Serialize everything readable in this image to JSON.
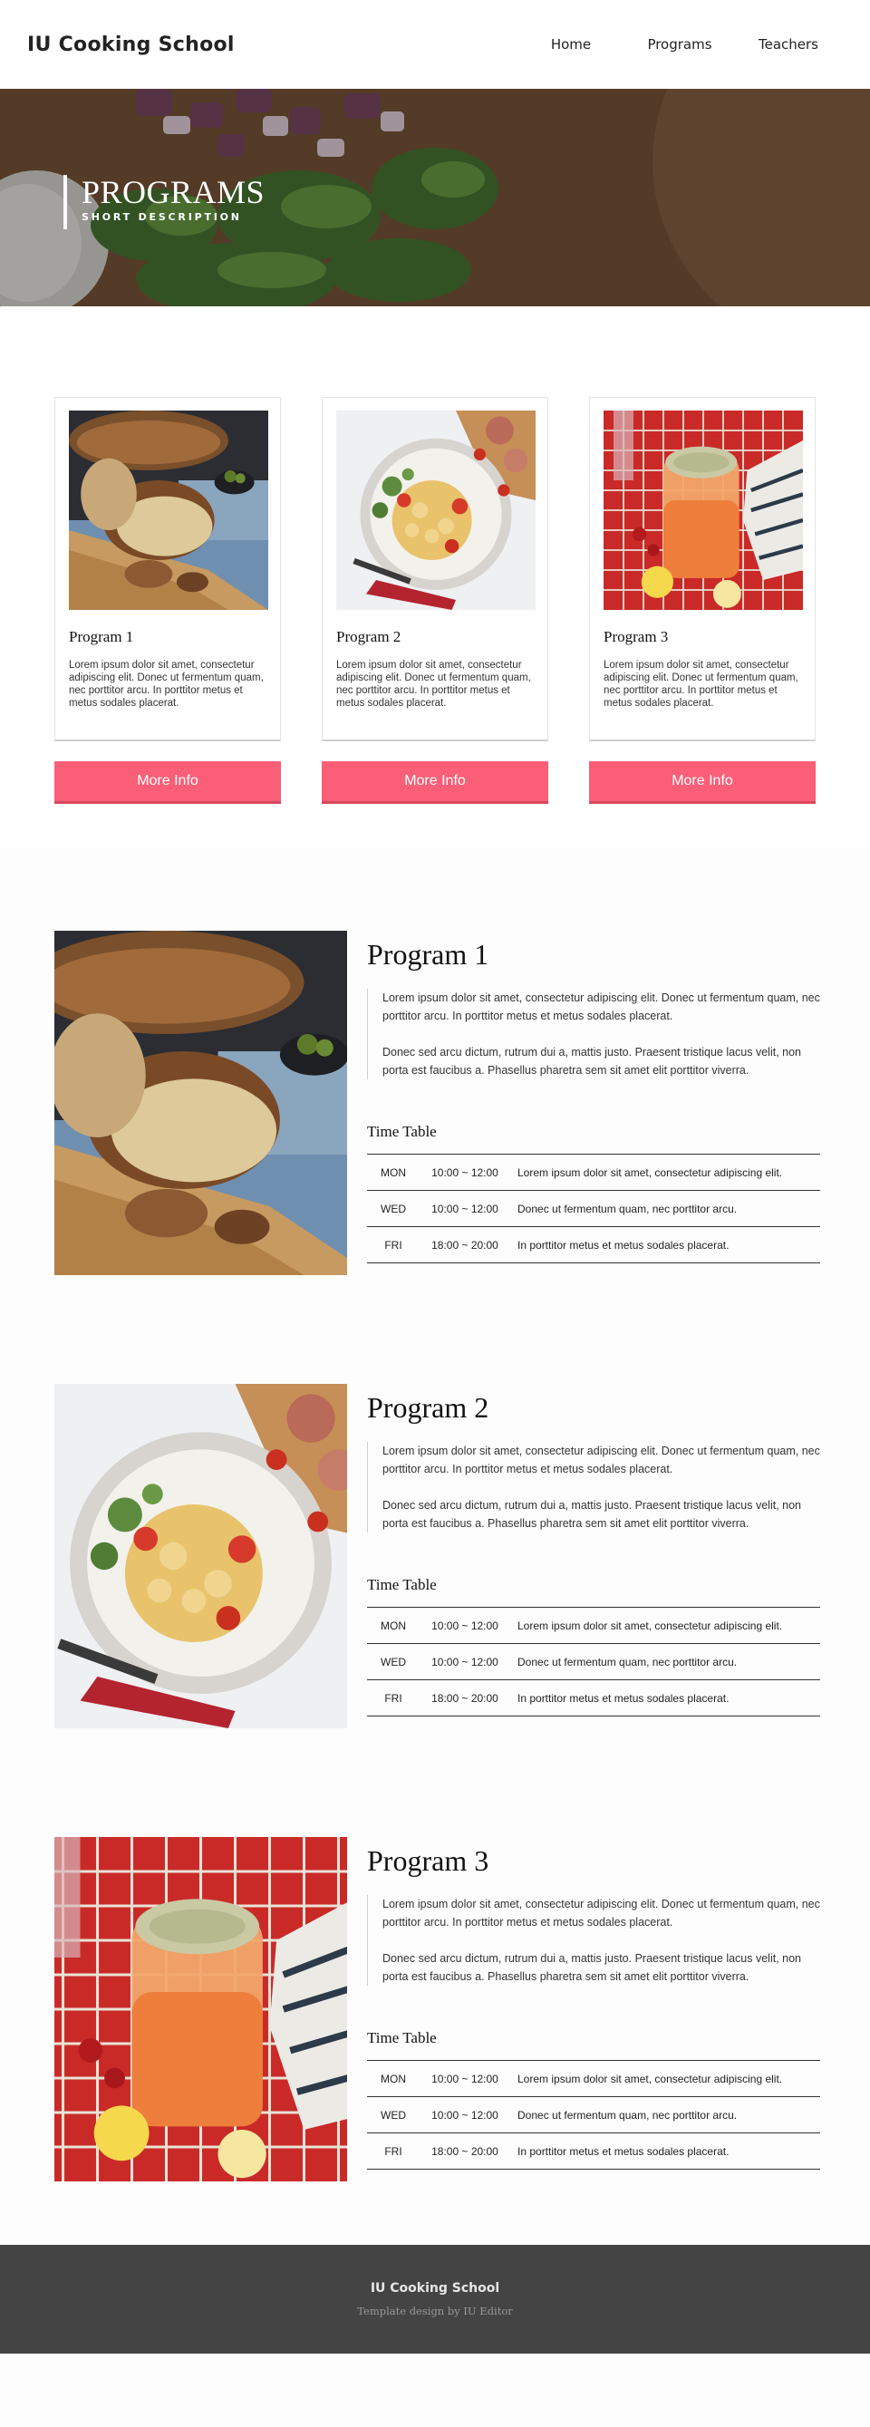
{
  "header": {
    "brand": "IU Cooking School",
    "nav": [
      "Home",
      "Programs",
      "Teachers"
    ]
  },
  "hero": {
    "title": "PROGRAMS",
    "subtitle": "SHORT DESCRIPTION"
  },
  "cards": [
    {
      "title": "Program 1",
      "text": "Lorem ipsum dolor sit amet, consectetur adipiscing elit. Donec ut fermentum quam, nec porttitor arcu. In porttitor metus et metus sodales placerat.",
      "button": "More Info"
    },
    {
      "title": "Program 2",
      "text": "Lorem ipsum dolor sit amet, consectetur adipiscing elit. Donec ut fermentum quam, nec porttitor arcu. In porttitor metus et metus sodales placerat.",
      "button": "More Info"
    },
    {
      "title": "Program 3",
      "text": "Lorem ipsum dolor sit amet, consectetur adipiscing elit. Donec ut fermentum quam, nec porttitor arcu. In porttitor metus et metus sodales placerat.",
      "button": "More Info"
    }
  ],
  "programs": [
    {
      "title": "Program 1",
      "paragraphs": [
        "Lorem ipsum dolor sit amet, consectetur adipiscing elit. Donec ut fermentum quam, nec porttitor arcu. In porttitor metus et metus sodales placerat.",
        "Donec sed arcu dictum, rutrum dui a, mattis justo. Praesent tristique lacus velit, non porta est faucibus a. Phasellus pharetra sem sit amet elit porttitor viverra."
      ],
      "timetable_heading": "Time Table",
      "rows": [
        {
          "day": "MON",
          "time": "10:00 ~ 12:00",
          "note": "Lorem ipsum dolor sit amet, consectetur adipiscing elit."
        },
        {
          "day": "WED",
          "time": "10:00 ~ 12:00",
          "note": "Donec ut fermentum quam, nec porttitor arcu."
        },
        {
          "day": "FRI",
          "time": "18:00 ~ 20:00",
          "note": "In porttitor metus et metus sodales placerat."
        }
      ]
    },
    {
      "title": "Program 2",
      "paragraphs": [
        "Lorem ipsum dolor sit amet, consectetur adipiscing elit. Donec ut fermentum quam, nec porttitor arcu. In porttitor metus et metus sodales placerat.",
        "Donec sed arcu dictum, rutrum dui a, mattis justo. Praesent tristique lacus velit, non porta est faucibus a. Phasellus pharetra sem sit amet elit porttitor viverra."
      ],
      "timetable_heading": "Time Table",
      "rows": [
        {
          "day": "MON",
          "time": "10:00 ~ 12:00",
          "note": "Lorem ipsum dolor sit amet, consectetur adipiscing elit."
        },
        {
          "day": "WED",
          "time": "10:00 ~ 12:00",
          "note": "Donec ut fermentum quam, nec porttitor arcu."
        },
        {
          "day": "FRI",
          "time": "18:00 ~ 20:00",
          "note": "In porttitor metus et metus sodales placerat."
        }
      ]
    },
    {
      "title": "Program 3",
      "paragraphs": [
        "Lorem ipsum dolor sit amet, consectetur adipiscing elit. Donec ut fermentum quam, nec porttitor arcu. In porttitor metus et metus sodales placerat.",
        "Donec sed arcu dictum, rutrum dui a, mattis justo. Praesent tristique lacus velit, non porta est faucibus a. Phasellus pharetra sem sit amet elit porttitor viverra."
      ],
      "timetable_heading": "Time Table",
      "rows": [
        {
          "day": "MON",
          "time": "10:00 ~ 12:00",
          "note": "Lorem ipsum dolor sit amet, consectetur adipiscing elit."
        },
        {
          "day": "WED",
          "time": "10:00 ~ 12:00",
          "note": "Donec ut fermentum quam, nec porttitor arcu."
        },
        {
          "day": "FRI",
          "time": "18:00 ~ 20:00",
          "note": "In porttitor metus et metus sodales placerat."
        }
      ]
    }
  ],
  "footer": {
    "brand": "IU Cooking School",
    "credit": "Template design by IU Editor"
  },
  "colors": {
    "accent": "#fa5f77",
    "footer_bg": "#444444",
    "page_bg": "#fcfdfc"
  },
  "images": {
    "hero": "food-prep-photo",
    "program_1": "bread-photo",
    "program_2": "gnocchi-photo",
    "program_3": "juice-photo"
  }
}
